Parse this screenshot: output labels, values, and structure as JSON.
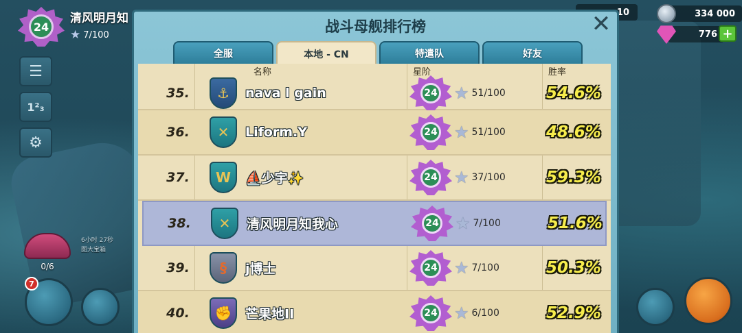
{
  "player": {
    "name": "清风明月知",
    "level": "24",
    "stars": "7/100"
  },
  "resources": {
    "partial": "10",
    "steel": "334 000",
    "gems": "776",
    "plus": "+"
  },
  "chest": {
    "count": "0/6",
    "timer": "6小时 27秒",
    "label": "图大宝箱"
  },
  "notification_count": "7",
  "leaderboard": {
    "title": "战斗母舰排行榜",
    "close": "✕",
    "tabs": [
      {
        "label": "全服"
      },
      {
        "label": "本地 - CN"
      },
      {
        "label": "特遣队"
      },
      {
        "label": "好友"
      }
    ],
    "active_tab": "本地 - CN",
    "columns": {
      "name": "名称",
      "rank": "星阶",
      "winrate": "胜率"
    },
    "rows": [
      {
        "rank": "35.",
        "name": "nava l gain",
        "level": "24",
        "stars": "51/100",
        "winrate": "54.6%",
        "emblem": "trident-emblem-icon",
        "emblem_glyph": "⚓"
      },
      {
        "rank": "36.",
        "name": "Liform.Y",
        "level": "24",
        "stars": "51/100",
        "winrate": "48.6%",
        "emblem": "crossed-rifles-emblem-icon",
        "emblem_glyph": "✕"
      },
      {
        "rank": "37.",
        "name": "⛵少宇✨",
        "level": "24",
        "stars": "37/100",
        "winrate": "59.3%",
        "emblem": "wings-emblem-icon",
        "emblem_glyph": "W"
      },
      {
        "rank": "38.",
        "name": "清风明月知我心",
        "level": "24",
        "stars": "7/100",
        "winrate": "51.6%",
        "emblem": "crossed-swords-emblem-icon",
        "emblem_glyph": "✕"
      },
      {
        "rank": "39.",
        "name": "j博士",
        "level": "24",
        "stars": "7/100",
        "winrate": "50.3%",
        "emblem": "dragon-emblem-icon",
        "emblem_glyph": "§"
      },
      {
        "rank": "40.",
        "name": "芒果地II",
        "level": "24",
        "stars": "6/100",
        "winrate": "52.9%",
        "emblem": "fist-emblem-icon",
        "emblem_glyph": "✊"
      }
    ]
  }
}
